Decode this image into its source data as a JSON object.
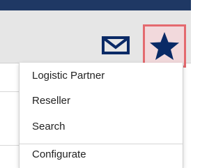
{
  "toolbar": {
    "icons": {
      "mail": "envelope-icon",
      "favorites": "star-icon"
    },
    "colors": {
      "topbar": "#1f3864",
      "icon": "#0a2a66",
      "highlight_border": "#e46a6f"
    }
  },
  "menu": {
    "items": [
      {
        "label": "Logistic Partner"
      },
      {
        "label": "Reseller"
      },
      {
        "label": "Search"
      },
      {
        "label": "Configurate"
      }
    ]
  }
}
